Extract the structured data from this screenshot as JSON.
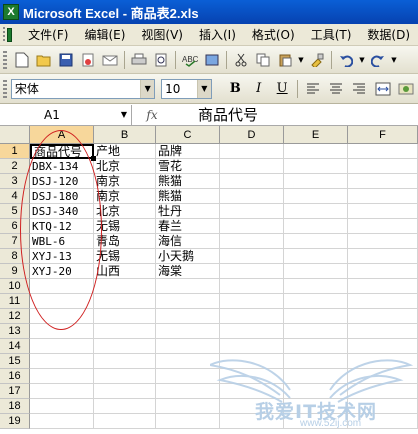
{
  "window": {
    "title": "Microsoft Excel - 商品表2.xls"
  },
  "menu": [
    "文件(F)",
    "编辑(E)",
    "视图(V)",
    "插入(I)",
    "格式(O)",
    "工具(T)",
    "数据(D)"
  ],
  "toolbar": {
    "icons": [
      "new-icon",
      "open-icon",
      "save-icon",
      "permission-icon",
      "email-icon",
      "print-icon",
      "print-preview-icon",
      "spelling-icon",
      "research-icon",
      "cut-icon",
      "copy-icon",
      "paste-icon",
      "format-painter-icon",
      "undo-icon",
      "redo-icon"
    ]
  },
  "format": {
    "font_name": "宋体",
    "font_size": "10",
    "bold": "B",
    "italic": "I",
    "underline": "U"
  },
  "formula": {
    "name_box": "A1",
    "fx": "fx",
    "content": "商品代号"
  },
  "columns": [
    "A",
    "B",
    "C",
    "D",
    "E",
    "F"
  ],
  "rows": [
    "1",
    "2",
    "3",
    "4",
    "5",
    "6",
    "7",
    "8",
    "9",
    "10",
    "11",
    "12",
    "13",
    "14",
    "15",
    "16",
    "17",
    "18",
    "19"
  ],
  "cells": [
    [
      "商品代号",
      "产地",
      "品牌"
    ],
    [
      "DBX-134",
      "北京",
      "雪花"
    ],
    [
      "DSJ-120",
      "南京",
      "熊猫"
    ],
    [
      "DSJ-180",
      "南京",
      "熊猫"
    ],
    [
      "DSJ-340",
      "北京",
      "牡丹"
    ],
    [
      "KTQ-12",
      "无锡",
      "春兰"
    ],
    [
      "WBL-6",
      "青岛",
      "海信"
    ],
    [
      "XYJ-13",
      "无锡",
      "小天鹅"
    ],
    [
      "XYJ-20",
      "山西",
      "海棠"
    ]
  ],
  "watermark": {
    "text": "我爱IT技术网",
    "url": "www.52ij.com"
  }
}
